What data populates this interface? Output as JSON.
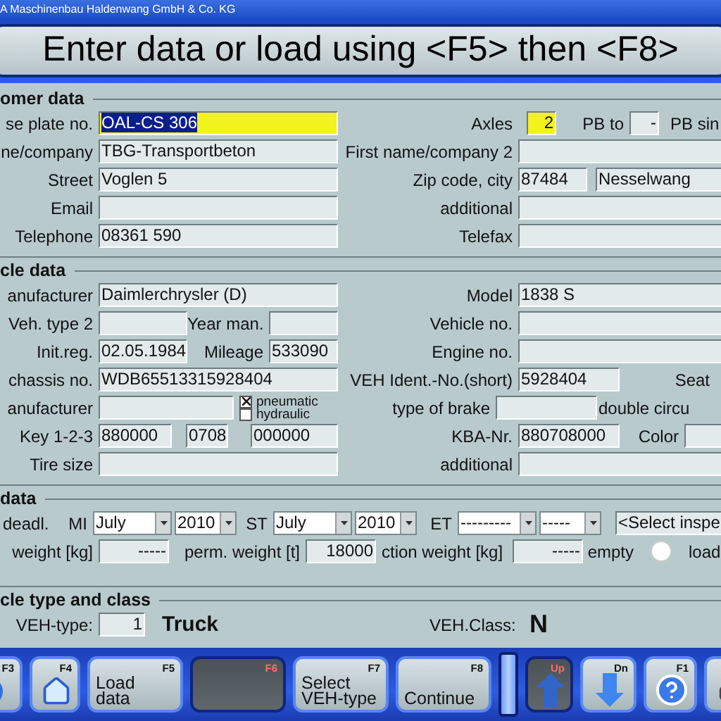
{
  "window": {
    "title": "A Maschinenbau Haldenwang GmbH & Co. KG"
  },
  "prompt": "Enter data or load using <F5> then <F8>",
  "customer": {
    "heading": "omer data",
    "plate": {
      "label": "se plate no.",
      "value": "OAL-CS 306",
      "highlighted": true,
      "text_selected": true
    },
    "axles": {
      "label": "Axles",
      "value": "2",
      "highlighted": true
    },
    "pb_to": {
      "label": "PB to",
      "value": "-"
    },
    "pb_single": {
      "label": "PB sin"
    },
    "name": {
      "label": "ne/company",
      "value": "TBG-Transportbeton"
    },
    "name2": {
      "label": "First name/company 2"
    },
    "street": {
      "label": "Street",
      "value": "Voglen 5"
    },
    "zip_city": {
      "label": "Zip code, city",
      "zip": "87484",
      "city": "Nesselwang"
    },
    "email": {
      "label": "Email"
    },
    "additional": {
      "label": "additional"
    },
    "telephone": {
      "label": "Telephone",
      "value": "08361 590"
    },
    "telefax": {
      "label": "Telefax"
    }
  },
  "vehicle": {
    "heading": "cle data",
    "manufacturer": {
      "label": "anufacturer",
      "value": "Daimlerchrysler (D)"
    },
    "model": {
      "label": "Model",
      "value": "1838 S"
    },
    "veh_type2": {
      "label": "Veh. type 2"
    },
    "year": {
      "label": "Year man."
    },
    "vehicle_no": {
      "label": "Vehicle no."
    },
    "init_reg": {
      "label": "Init.reg.",
      "value": "02.05.1984"
    },
    "mileage": {
      "label": "Mileage",
      "value": "533090"
    },
    "engine_no": {
      "label": "Engine no."
    },
    "chassis": {
      "label": "chassis no.",
      "value": "WDB65513315928404"
    },
    "ident_short": {
      "label": "VEH Ident.-No.(short)",
      "value": "5928404"
    },
    "seat": {
      "label": "Seat"
    },
    "brake_manufacturer": {
      "label": "anufacturer"
    },
    "brake_systems": [
      {
        "label": "pneumatic",
        "checked": true
      },
      {
        "label": "hydraulic",
        "checked": false
      }
    ],
    "brake_type": {
      "label": "type of brake"
    },
    "double_circuit": {
      "label": "double circu"
    },
    "key": {
      "label": "Key 1-2-3",
      "values": [
        "880000",
        "0708",
        "000000"
      ]
    },
    "kba": {
      "label": "KBA-Nr.",
      "value": "880708000"
    },
    "color": {
      "label": "Color"
    },
    "tire": {
      "label": "Tire size"
    },
    "additional": {
      "label": "additional"
    }
  },
  "inspection": {
    "heading": "data",
    "deadline": {
      "label": "deadl."
    },
    "groups": [
      {
        "label": "MI",
        "month": "July",
        "year": "2010"
      },
      {
        "label": "ST",
        "month": "July",
        "year": "2010"
      },
      {
        "label": "ET",
        "month": "---------",
        "year": "-----"
      }
    ],
    "select_inspection": "<Select inspe",
    "weight": {
      "label": "weight [kg]",
      "value": "-----"
    },
    "perm_weight": {
      "label": "perm. weight [t]",
      "value": "18000"
    },
    "axle_weight": {
      "label": "ction weight [kg]",
      "value": "-----"
    },
    "load_state": [
      {
        "label": "empty",
        "selected": false
      }
    ],
    "load_label": "load"
  },
  "type_class": {
    "heading": "cle type and class",
    "veh_type": {
      "label": "VEH-type:",
      "value": "1",
      "name": "Truck"
    },
    "veh_class": {
      "label": "VEH.Class:",
      "value": "N"
    }
  },
  "toolbar": [
    {
      "key": "F3",
      "kind": "forward",
      "disabled": false
    },
    {
      "key": "F4",
      "kind": "home",
      "disabled": false
    },
    {
      "key": "F5",
      "kind": "text",
      "label": "Load\ndata",
      "disabled": false
    },
    {
      "key": "F6",
      "kind": "text",
      "disabled": true
    },
    {
      "key": "F7",
      "kind": "text",
      "label": "Select\nVEH-type",
      "disabled": false
    },
    {
      "key": "F8",
      "kind": "text",
      "label": "\nContinue",
      "disabled": false
    },
    {
      "key": "Up",
      "kind": "up",
      "disabled": true
    },
    {
      "key": "Dn",
      "kind": "down",
      "disabled": false
    },
    {
      "key": "F1",
      "kind": "help",
      "disabled": false
    },
    {
      "kind": "print",
      "disabled": false
    }
  ]
}
